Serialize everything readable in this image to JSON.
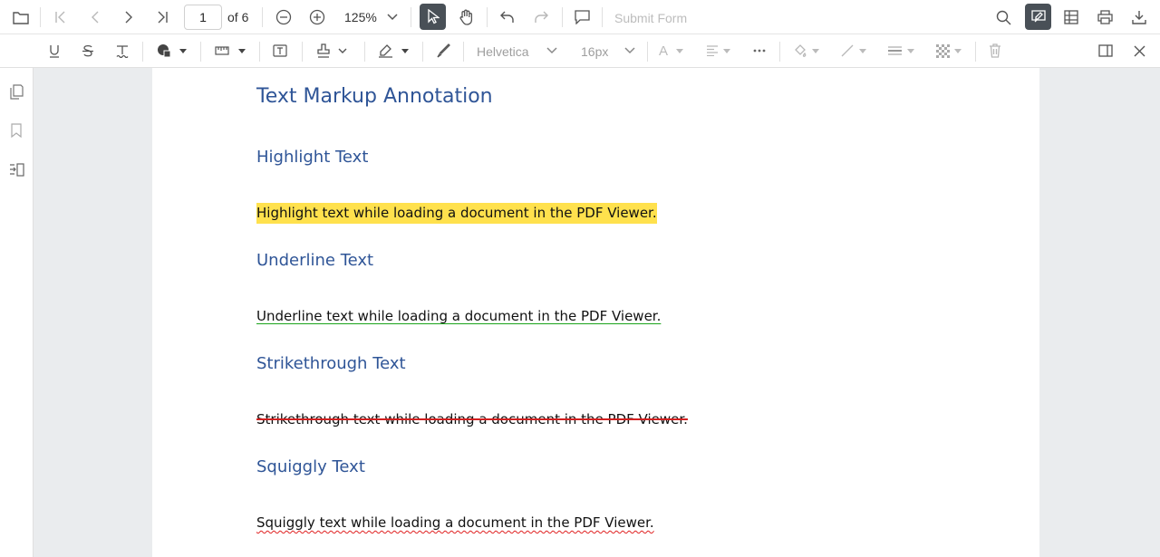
{
  "toolbar": {
    "page_number": "1",
    "page_of": "of 6",
    "zoom": "125%",
    "submit_form": "Submit Form"
  },
  "annotation_toolbar": {
    "font_name": "Helvetica",
    "font_size": "16px",
    "font_color_glyph": "A"
  },
  "document": {
    "title": "Text Markup Annotation",
    "sections": [
      {
        "heading": "Highlight Text",
        "text": "Highlight text while loading a document in the PDF Viewer.",
        "color": "#ffe14d"
      },
      {
        "heading": "Underline Text",
        "text": "Underline text while loading a document in the PDF Viewer.",
        "color": "#1aa31a"
      },
      {
        "heading": "Strikethrough Text",
        "text": "Strikethrough text while loading a document in the PDF Viewer.",
        "color": "#d21f1f"
      },
      {
        "heading": "Squiggly Text",
        "text": "Squiggly text while loading a document in the PDF Viewer.",
        "color": "#e02020"
      }
    ]
  },
  "colors": {
    "heading": "#2f5597",
    "active_button": "#495057",
    "viewer_background": "#eaecee"
  }
}
